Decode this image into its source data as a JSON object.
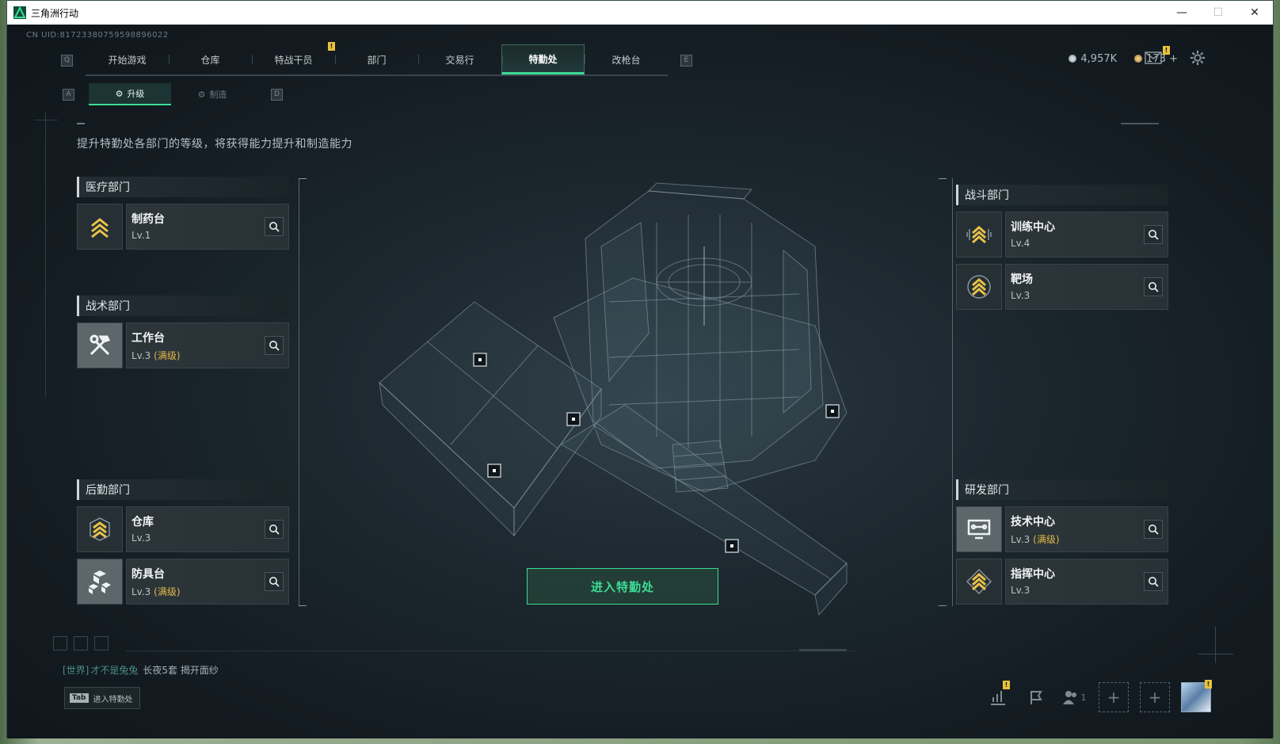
{
  "window": {
    "title": "三角洲行动"
  },
  "uid": "CN UID:81723380759598896022",
  "nav": {
    "left_key": "Q",
    "right_key": "E",
    "tabs": [
      {
        "label": "开始游戏",
        "active": false
      },
      {
        "label": "仓库",
        "active": false
      },
      {
        "label": "特战干员",
        "active": false,
        "badge": "!"
      },
      {
        "label": "部门",
        "active": false
      },
      {
        "label": "交易行",
        "active": false
      },
      {
        "label": "特勤处",
        "active": true
      },
      {
        "label": "改枪台",
        "active": false
      }
    ]
  },
  "currency": {
    "coins": "4,957K",
    "premium": "173 +"
  },
  "subnav": {
    "left_key": "A",
    "right_key": "D",
    "tabs": [
      {
        "label": "升级",
        "active": true
      },
      {
        "label": "制造",
        "active": false
      }
    ]
  },
  "hint": "提升特勤处各部门的等级，将获得能力提升和制造能力",
  "departments": {
    "medical": {
      "name": "医疗部门",
      "facilities": [
        {
          "name": "制药台",
          "level": "Lv.1",
          "max": ""
        }
      ]
    },
    "tactical": {
      "name": "战术部门",
      "facilities": [
        {
          "name": "工作台",
          "level": "Lv.3",
          "max": "(满级)"
        }
      ]
    },
    "logistics": {
      "name": "后勤部门",
      "facilities": [
        {
          "name": "仓库",
          "level": "Lv.3",
          "max": ""
        },
        {
          "name": "防具台",
          "level": "Lv.3",
          "max": "(满级)"
        }
      ]
    },
    "combat": {
      "name": "战斗部门",
      "facilities": [
        {
          "name": "训练中心",
          "level": "Lv.4",
          "max": ""
        },
        {
          "name": "靶场",
          "level": "Lv.3",
          "max": ""
        }
      ]
    },
    "rnd": {
      "name": "研发部门",
      "facilities": [
        {
          "name": "技术中心",
          "level": "Lv.3",
          "max": "(满级)"
        },
        {
          "name": "指挥中心",
          "level": "Lv.3",
          "max": ""
        }
      ]
    }
  },
  "enter_button": "进入特勤处",
  "chat": {
    "channel": "[世界]",
    "user": "才不是兔兔",
    "message": "长夜5套 揭开面纱"
  },
  "tab_hint": {
    "key": "Tab",
    "label": "进入特勤处"
  },
  "bottom": {
    "friends_count": "1"
  },
  "colors": {
    "accent": "#3ddc97",
    "max_level": "#e3b84a",
    "badge": "#e9c23a"
  }
}
